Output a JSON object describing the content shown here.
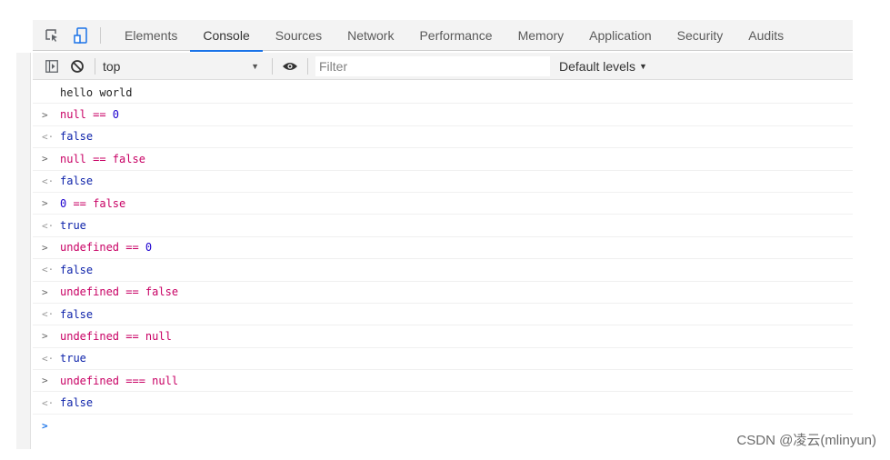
{
  "devtools": {
    "tabs": [
      {
        "label": "Elements"
      },
      {
        "label": "Console"
      },
      {
        "label": "Sources"
      },
      {
        "label": "Network"
      },
      {
        "label": "Performance"
      },
      {
        "label": "Memory"
      },
      {
        "label": "Application"
      },
      {
        "label": "Security"
      },
      {
        "label": "Audits"
      }
    ],
    "active_tab": "Console"
  },
  "toolbar": {
    "context_value": "top",
    "filter_placeholder": "Filter",
    "levels_label": "Default levels",
    "levels_caret": "▼",
    "context_caret": "▼"
  },
  "console": {
    "log_text": "hello world",
    "entries": [
      {
        "input_kw": "null == ",
        "input_num": "0",
        "output": "false"
      },
      {
        "input": "null == false",
        "output": "false"
      },
      {
        "input_num": "0",
        "input_kw": " == false",
        "output": "true"
      },
      {
        "input_kw": "undefined == ",
        "input_num": "0",
        "output": "false"
      },
      {
        "input": "undefined == false",
        "output": "false"
      },
      {
        "input": "undefined == null",
        "output": "true"
      },
      {
        "input": "undefined === null",
        "output": "false"
      }
    ],
    "input_marker": ">",
    "output_marker": "<·",
    "prompt_marker": ">"
  },
  "watermark": "CSDN @凌云(mlinyun)",
  "colors": {
    "accent": "#1a73e8",
    "input_text": "#c80064",
    "number": "#1c00cf",
    "output_text": "#0d22aa"
  }
}
